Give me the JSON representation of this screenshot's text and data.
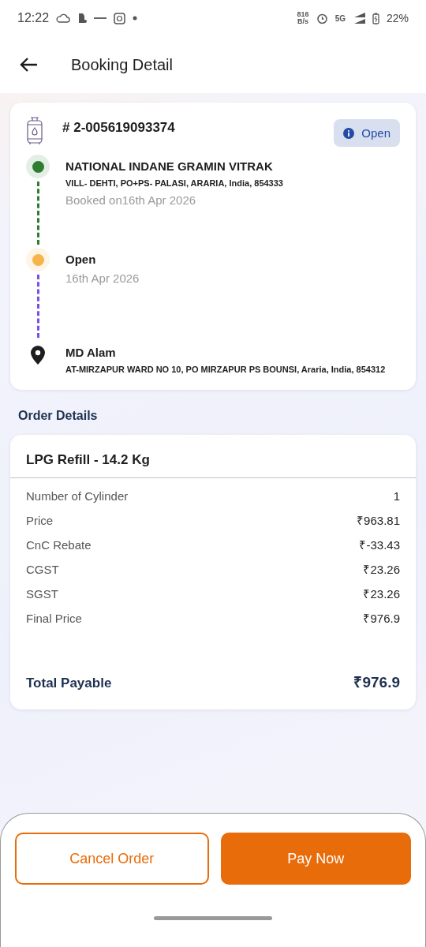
{
  "status_bar": {
    "time": "12:22",
    "net_speed": "816",
    "net_unit": "B/s",
    "network": "5G",
    "battery": "22%"
  },
  "header": {
    "title": "Booking Detail"
  },
  "booking": {
    "number": "# 2-005619093374",
    "status": "Open",
    "steps": [
      {
        "kind": "dot",
        "color": "#2e7d32",
        "connector": {
          "color": "#2e7d32"
        },
        "title": "NATIONAL INDANE GRAMIN VITRAK",
        "address": "VILL- DEHTI, PO+PS- PALASI, ARARIA, India, 854333",
        "note": "Booked on16th Apr 2026"
      },
      {
        "kind": "dot",
        "color": "#f6b44a",
        "connector": {
          "color": "#7b4fe0"
        },
        "title": "Open",
        "note": "16th Apr 2026"
      },
      {
        "kind": "pin",
        "title": "MD Alam",
        "address": "AT-MIRZAPUR WARD NO 10, PO MIRZAPUR PS BOUNSI, Araria, India, 854312"
      }
    ]
  },
  "order_details": {
    "heading": "Order Details",
    "product": "LPG Refill - 14.2 Kg",
    "rows": [
      {
        "label": "Number of Cylinder",
        "value": "1"
      },
      {
        "label": "Price",
        "value": "₹963.81"
      },
      {
        "label": "CnC Rebate",
        "value": "₹-33.43"
      },
      {
        "label": "CGST",
        "value": "₹23.26"
      },
      {
        "label": "SGST",
        "value": "₹23.26"
      },
      {
        "label": "Final Price",
        "value": "₹976.9"
      }
    ],
    "total_label": "Total Payable",
    "total_value": "₹976.9"
  },
  "actions": [
    {
      "kind": "outline",
      "label": "Cancel Order"
    },
    {
      "kind": "filled",
      "label": "Pay Now"
    }
  ]
}
